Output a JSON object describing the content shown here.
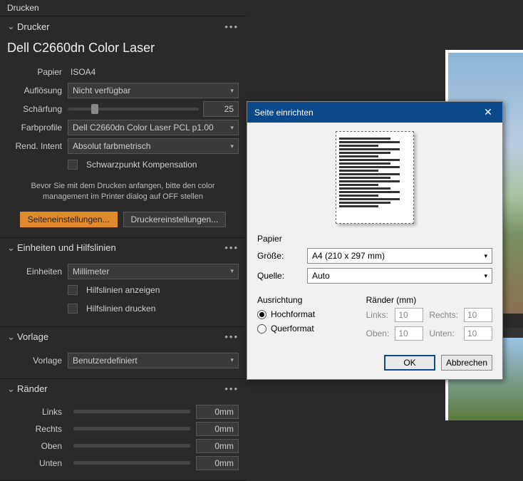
{
  "window_title": "Drucken",
  "sections": {
    "printer": {
      "title": "Drucker",
      "name": "Dell C2660dn Color Laser",
      "paper_label": "Papier",
      "paper_value": "ISOA4",
      "resolution_label": "Auflösung",
      "resolution_value": "Nicht verfügbar",
      "sharpen_label": "Schärfung",
      "sharpen_value": "25",
      "profile_label": "Farbprofile",
      "profile_value": "Dell C2660dn Color Laser PCL p1.00",
      "intent_label": "Rend. Intent",
      "intent_value": "Absolut farbmetrisch",
      "blackpoint_label": "Schwarzpunkt Kompensation",
      "hint": "Bevor Sie mit dem Drucken anfangen, bitte den color management im Printer dialog auf OFF stellen",
      "btn_page": "Seiteneinstellungen...",
      "btn_printer": "Druckereinstellungen..."
    },
    "units": {
      "title": "Einheiten und Hilfslinien",
      "units_label": "Einheiten",
      "units_value": "Millimeter",
      "show_guides": "Hilfslinien anzeigen",
      "print_guides": "Hilfslinien drucken"
    },
    "template": {
      "title": "Vorlage",
      "label": "Vorlage",
      "value": "Benutzerdefiniert"
    },
    "margins": {
      "title": "Ränder",
      "left": "Links",
      "left_v": "0mm",
      "right": "Rechts",
      "right_v": "0mm",
      "top": "Oben",
      "top_v": "0mm",
      "bottom": "Unten",
      "bottom_v": "0mm"
    }
  },
  "dialog": {
    "title": "Seite einrichten",
    "paper_group": "Papier",
    "size_label": "Größe:",
    "size_value": "A4 (210 x 297 mm)",
    "source_label": "Quelle:",
    "source_value": "Auto",
    "orient_group": "Ausrichtung",
    "portrait": "Hochformat",
    "landscape": "Querformat",
    "margins_group": "Ränder (mm)",
    "m_left": "Links:",
    "m_left_v": "10",
    "m_right": "Rechts:",
    "m_right_v": "10",
    "m_top": "Oben:",
    "m_top_v": "10",
    "m_bottom": "Unten:",
    "m_bottom_v": "10",
    "ok": "OK",
    "cancel": "Abbrechen"
  }
}
